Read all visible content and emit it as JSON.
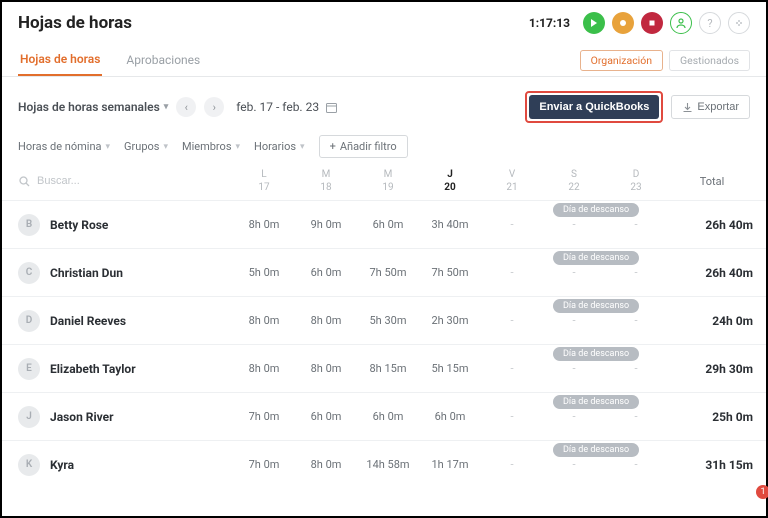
{
  "header": {
    "title": "Hojas de horas",
    "timer": "1:17:13"
  },
  "tabs": {
    "timesheets": "Hojas de horas",
    "approvals": "Aprobaciones",
    "organization": "Organización",
    "managed": "Gestionados"
  },
  "toolbar": {
    "view_label": "Hojas de horas semanales",
    "date_range": "feb. 17 - feb. 23",
    "send_qb": "Enviar a QuickBooks",
    "export": "Exportar"
  },
  "filters": {
    "payroll": "Horas de nómina",
    "groups": "Grupos",
    "members": "Miembros",
    "schedules": "Horarios",
    "add": "Añadir filtro"
  },
  "search": {
    "placeholder": "Buscar..."
  },
  "days": [
    {
      "letter": "L",
      "num": "17"
    },
    {
      "letter": "M",
      "num": "18"
    },
    {
      "letter": "M",
      "num": "19"
    },
    {
      "letter": "J",
      "num": "20"
    },
    {
      "letter": "V",
      "num": "21"
    },
    {
      "letter": "S",
      "num": "22"
    },
    {
      "letter": "D",
      "num": "23"
    }
  ],
  "today_index": 3,
  "total_label": "Total",
  "rest_label": "Día de descanso",
  "rows": [
    {
      "initial": "B",
      "name": "Betty Rose",
      "cells": [
        "8h 0m",
        "9h 0m",
        "6h 0m",
        "3h 40m",
        "-",
        "-",
        "-"
      ],
      "total": "26h 40m"
    },
    {
      "initial": "C",
      "name": "Christian Dun",
      "cells": [
        "5h 0m",
        "6h 0m",
        "7h 50m",
        "7h 50m",
        "-",
        "-",
        "-"
      ],
      "total": "26h 40m"
    },
    {
      "initial": "D",
      "name": "Daniel Reeves",
      "cells": [
        "8h 0m",
        "8h 0m",
        "5h 30m",
        "2h 30m",
        "-",
        "-",
        "-"
      ],
      "total": "24h 0m"
    },
    {
      "initial": "E",
      "name": "Elizabeth Taylor",
      "cells": [
        "8h 0m",
        "8h 0m",
        "8h 15m",
        "5h 15m",
        "-",
        "-",
        "-"
      ],
      "total": "29h 30m"
    },
    {
      "initial": "J",
      "name": "Jason River",
      "cells": [
        "7h 0m",
        "6h 0m",
        "6h 0m",
        "6h 0m",
        "-",
        "-",
        "-"
      ],
      "total": "25h 0m"
    },
    {
      "initial": "K",
      "name": "Kyra",
      "cells": [
        "7h 0m",
        "8h 0m",
        "14h 58m",
        "1h 17m",
        "-",
        "-",
        "-"
      ],
      "total": "31h 15m"
    }
  ],
  "notification_count": "1"
}
